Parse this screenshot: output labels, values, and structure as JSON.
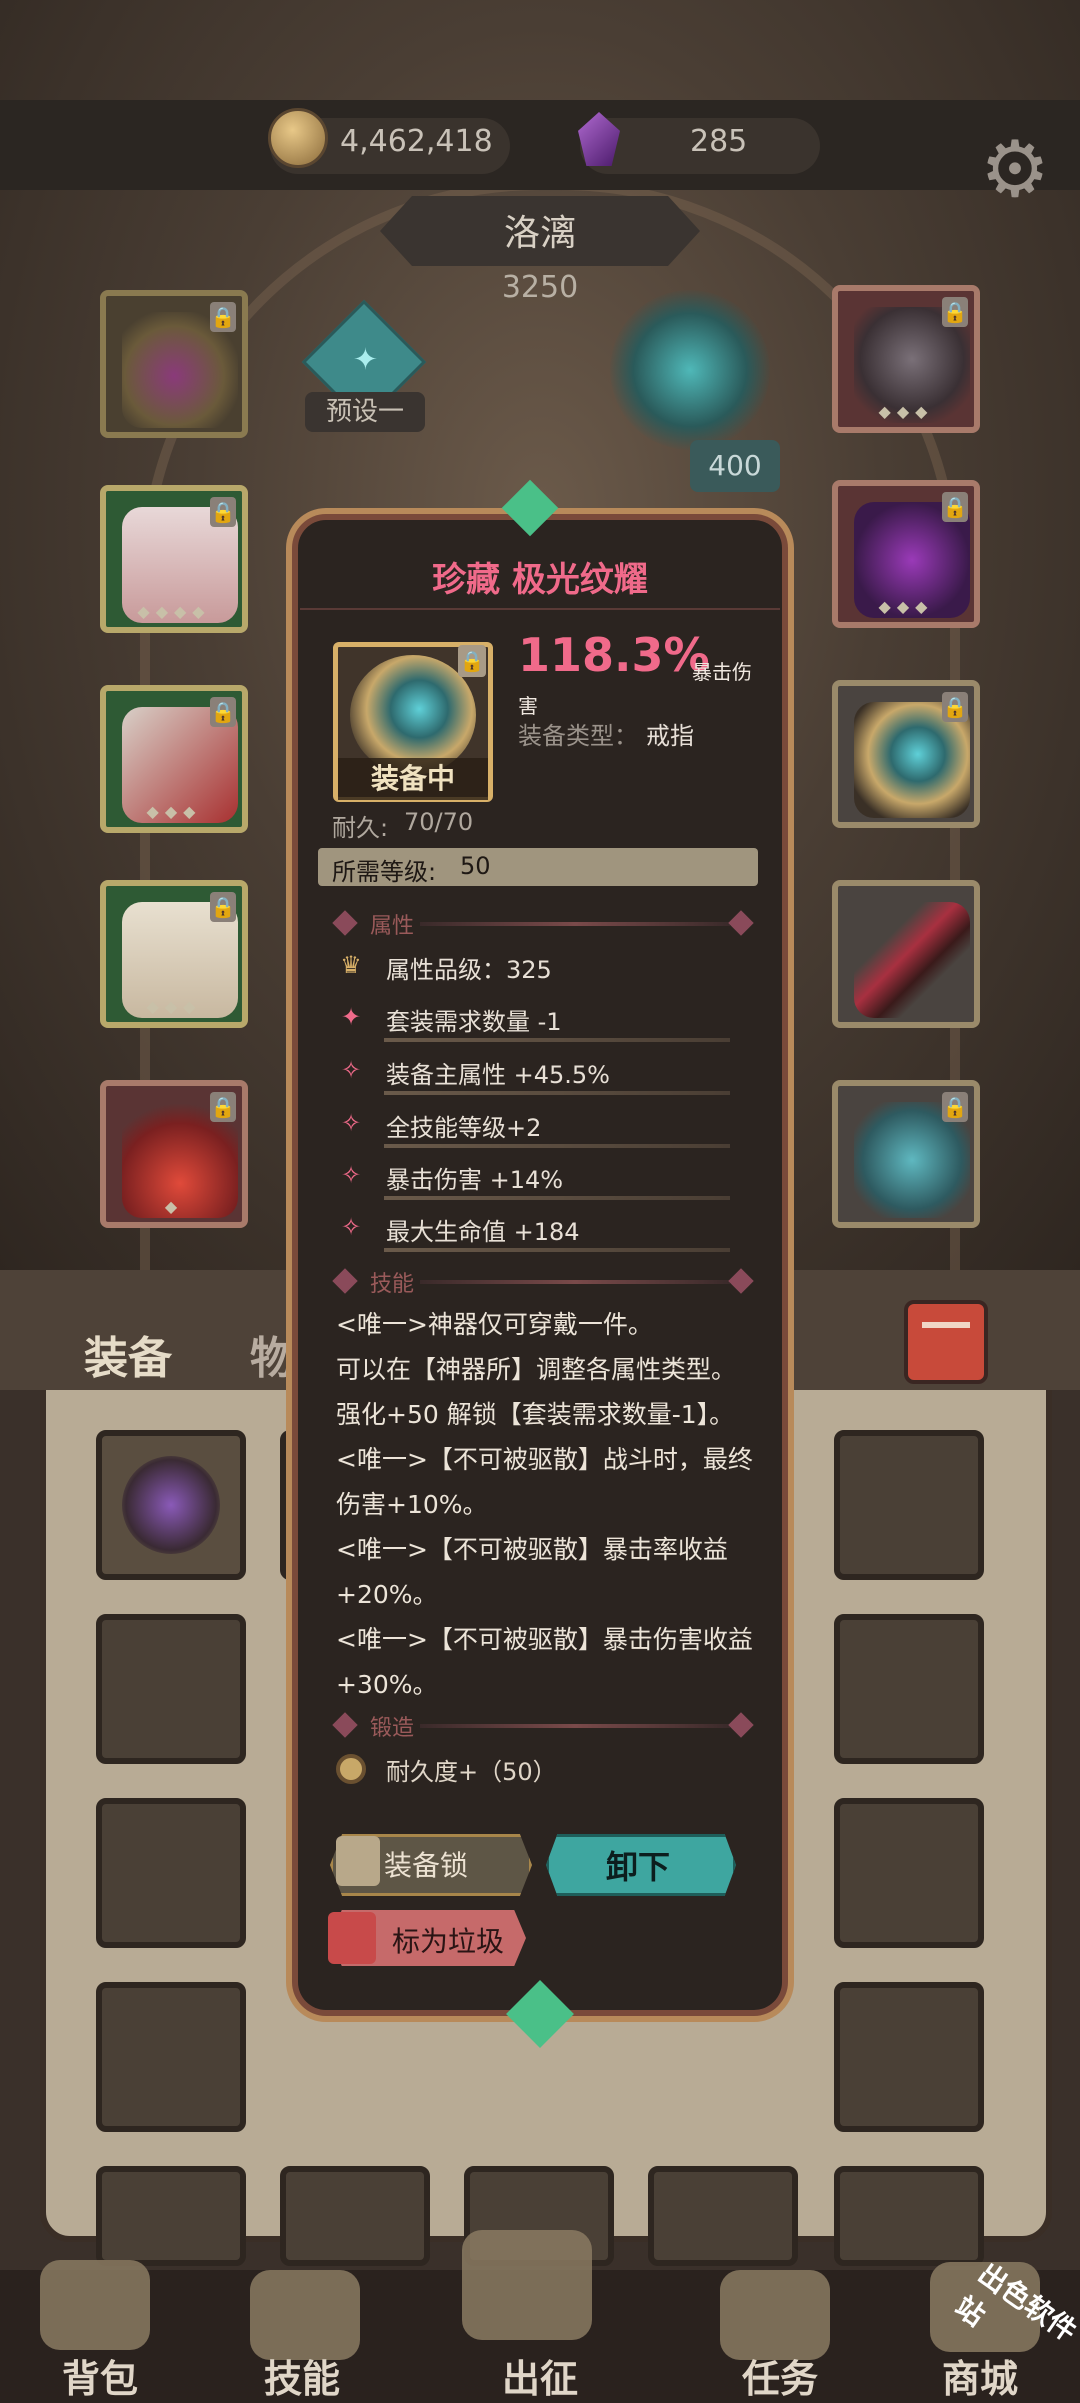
{
  "currency": {
    "gold": "4,462,418",
    "gems": "285"
  },
  "hero": {
    "name": "洛漓",
    "power": "3250"
  },
  "preset": {
    "icon": "preset-rune-icon",
    "label": "预设一"
  },
  "center": {
    "level_badge": "400"
  },
  "tabs": {
    "equip": "装备",
    "items": "物品"
  },
  "tooltip": {
    "title": "珍藏 极光纹耀",
    "title_color": "#f06a8a",
    "main_stat": "118.3%",
    "main_stat_suffix_a": "暴击伤",
    "main_stat_suffix_b": "害",
    "type_label": "装备类型：",
    "type_value": "戒指",
    "equipped_label": "装备中",
    "durability_label": "耐久:",
    "durability_value": "70/70",
    "req_label": "所需等级:",
    "req_value": "50",
    "attr_section": "属性",
    "attrs": [
      "属性品级：325",
      "套装需求数量 -1",
      "装备主属性 +45.5%",
      "全技能等级+2",
      "暴击伤害 +14%",
      "最大生命值 +184"
    ],
    "skill_section": "技能",
    "skills": [
      "<唯一>神器仅可穿戴一件。",
      "可以在【神器所】调整各属性类型。",
      "强化+50 解锁【套装需求数量-1】。",
      "<唯一>【不可被驱散】战斗时，最终",
      "伤害+10%。",
      "<唯一>【不可被驱散】暴击率收益",
      "+20%。",
      "<唯一>【不可被驱散】暴击伤害收益",
      "+30%。"
    ],
    "forge_section": "锻造",
    "forge_item": "耐久度+（50）",
    "buttons": {
      "lock": "装备锁",
      "unequip": "卸下",
      "trash": "标为垃圾"
    }
  },
  "nav": {
    "bag": "背包",
    "skills": "技能",
    "expedition": "出征",
    "tasks": "任务",
    "shop": "商城"
  },
  "watermark": "出色软件站"
}
